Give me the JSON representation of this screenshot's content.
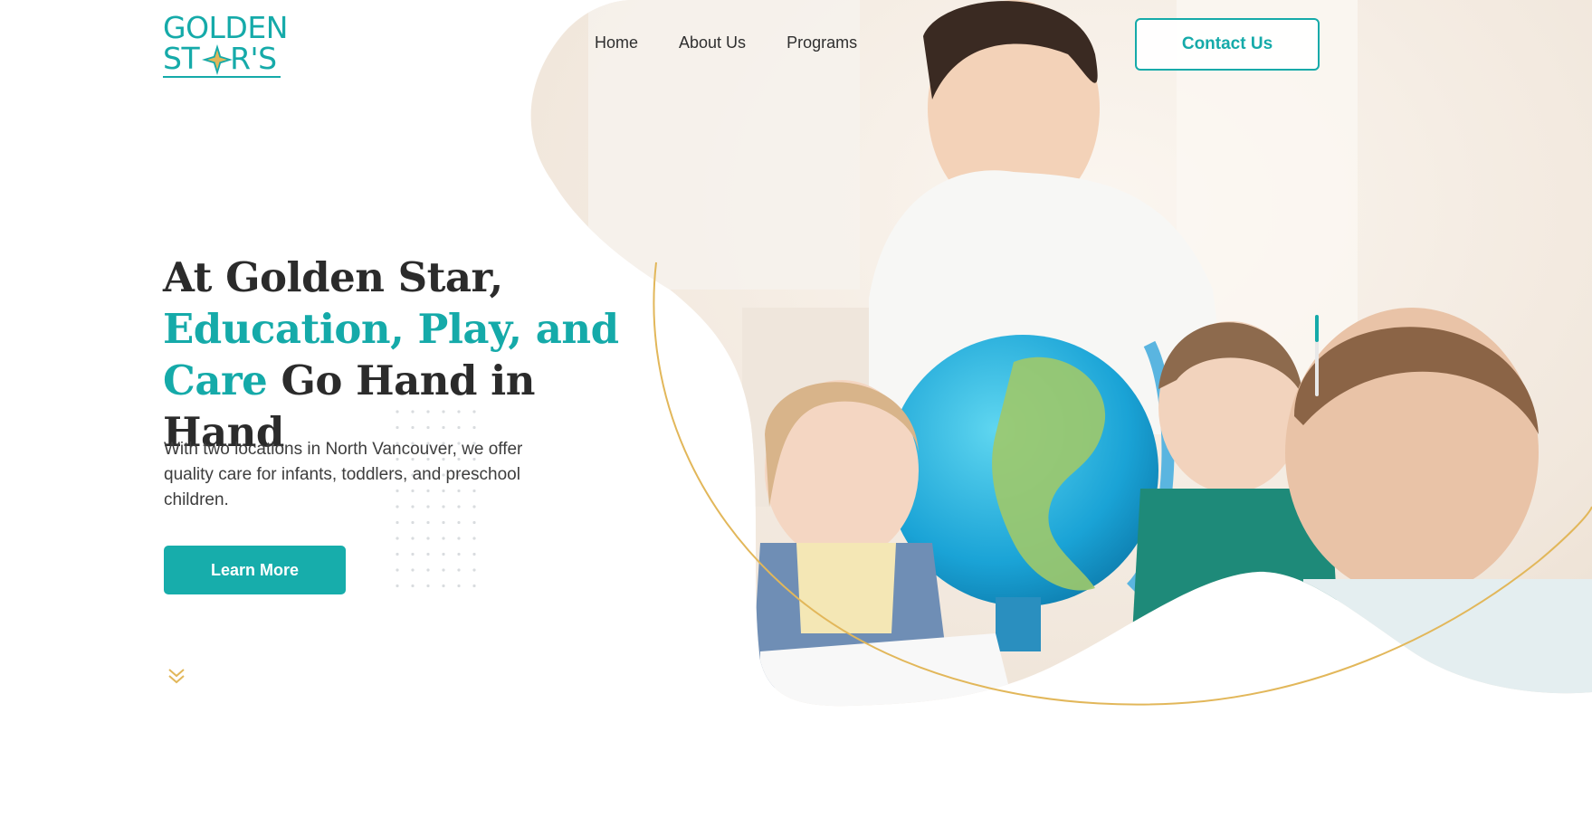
{
  "logo": {
    "line1": "GOLDEN",
    "line2_a": "ST",
    "line2_b": "R'S",
    "icon": "star-icon"
  },
  "nav": {
    "items": [
      "Home",
      "About Us",
      "Programs"
    ]
  },
  "header": {
    "contact_label": "Contact Us"
  },
  "hero": {
    "headline_part1": "At Golden Star,",
    "headline_accent1": "Education, Play, and",
    "headline_accent2": "Care",
    "headline_part2": " Go Hand in Hand",
    "description": "With two locations in North Vancouver, we offer quality care for infants, toddlers, and preschool children.",
    "cta_label": "Learn More",
    "scroll_icon": "chevron-double-down-icon"
  },
  "colors": {
    "brand": "#15aaa9",
    "gold": "#e2b75a",
    "text": "#2b2b2b"
  }
}
